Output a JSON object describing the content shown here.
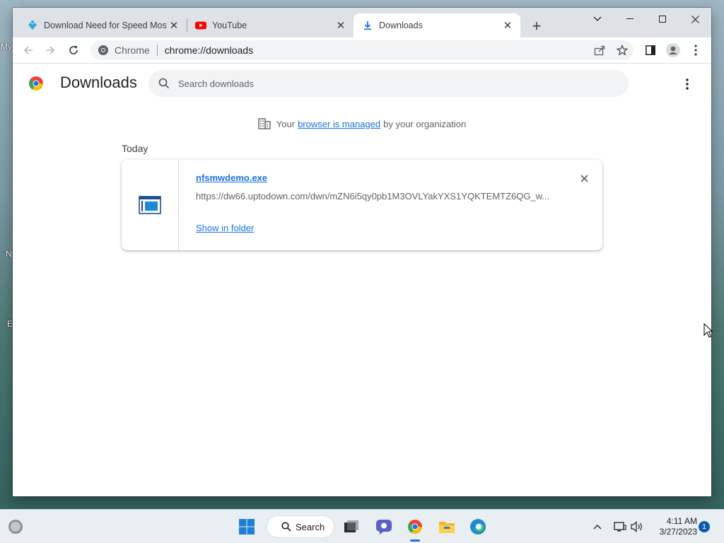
{
  "desktop": {
    "fragments": [
      "My",
      "N",
      "E"
    ]
  },
  "tabs": [
    {
      "title": "Download Need for Speed Most Wanted",
      "icon": "uptodown-icon",
      "active": false
    },
    {
      "title": "YouTube",
      "icon": "youtube-icon",
      "active": false
    },
    {
      "title": "Downloads",
      "icon": "download-icon",
      "active": true
    }
  ],
  "window_controls": {
    "tab_search": "chevron-down-icon",
    "minimize": "minimize-icon",
    "maximize": "maximize-icon",
    "close": "close-icon"
  },
  "omnibox": {
    "site_label": "Chrome",
    "url": "chrome://downloads"
  },
  "page": {
    "title": "Downloads",
    "search_placeholder": "Search downloads",
    "managed_prefix": "Your",
    "managed_link": "browser is managed",
    "managed_suffix": "by your organization",
    "section_label": "Today"
  },
  "downloads": [
    {
      "file_name": "nfsmwdemo.exe",
      "url": "https://dw66.uptodown.com/dwn/mZN6i5qy0pb1M3OVLYakYXS1YQKTEMTZ6QG_w...",
      "action": "Show in folder"
    }
  ],
  "taskbar": {
    "search_label": "Search",
    "time": "4:11 AM",
    "date": "3/27/2023",
    "notification_count": "1"
  },
  "colors": {
    "accent": "#1a73e8",
    "tabstrip": "#dee1e6",
    "youtube_red": "#ff0000"
  }
}
